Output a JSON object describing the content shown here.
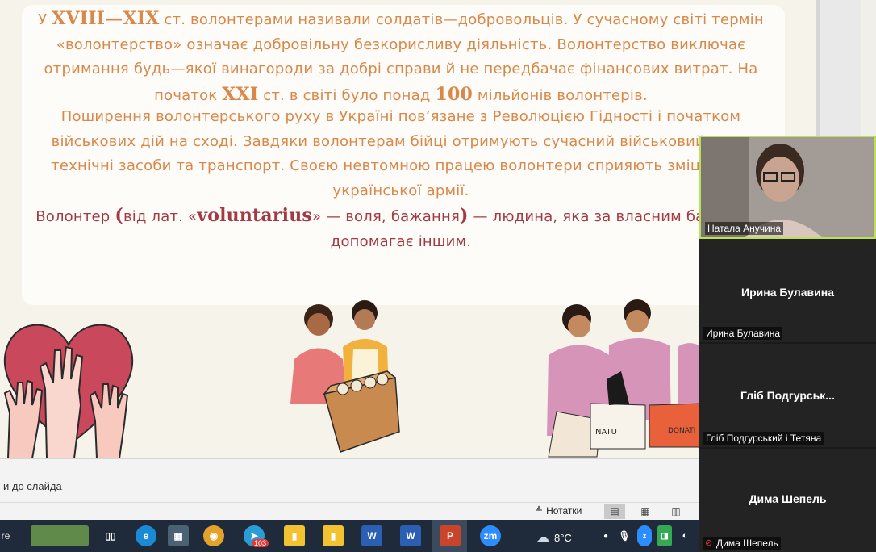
{
  "slide": {
    "para1": {
      "a": "У ",
      "b": "XVIII—XIX",
      "c": " ст. волонтерами називали солдатів—добровольців. У сучасному світі термін «волонтерство» означає добровільну безкорисливу діяльність. Волонтерство виключає отримання будь—якої винагороди за добрі справи й не передбачає фінансових витрат. На початок ",
      "d": "XXI",
      "e": " ст. в світі було понад ",
      "f": "100",
      "g": " мільйонів волонтерів."
    },
    "para2": "Поширення волонтерського руху в Україні пов’язане з Революцією Гідності і початком військових дій на сході. Завдяки волонтерам бійці отримують сучасний військовий одяг, технічні засоби та транспорт. Своєю невтомною працею волонтери сприяють зміцненню української армії.",
    "para3": {
      "a": "Волонтер ",
      "b": "(",
      "c": "від лат. «",
      "d": "voluntarius",
      "e": "» — воля, бажання",
      "f": ")",
      "g": " — людина, яка за власним бажанням допомагає іншим."
    },
    "box_label_1": "NATU",
    "box_label_2": "DONATI"
  },
  "notes": {
    "placeholder": "и до слайда"
  },
  "status": {
    "notes_label": "Нотатки"
  },
  "taskbar": {
    "left_text": "re",
    "telegram_badge": "103",
    "word1": "W",
    "word2": "W",
    "ppt": "P",
    "zoom": "zm",
    "weather": "8°C"
  },
  "participants": [
    {
      "name": "Натала Анучина",
      "video": true
    },
    {
      "name": "Ирина Булавина",
      "display": "Ирина Булавина"
    },
    {
      "name": "Гліб Подгурський і Тетяна",
      "display": "Гліб  Подгурськ..."
    },
    {
      "name": "Дима Шепель",
      "display": "Дима Шепель"
    }
  ],
  "colors": {
    "slide_text": "#d9884a",
    "definition_text": "#a23a44",
    "active_speaker_border": "#b9e05b"
  }
}
